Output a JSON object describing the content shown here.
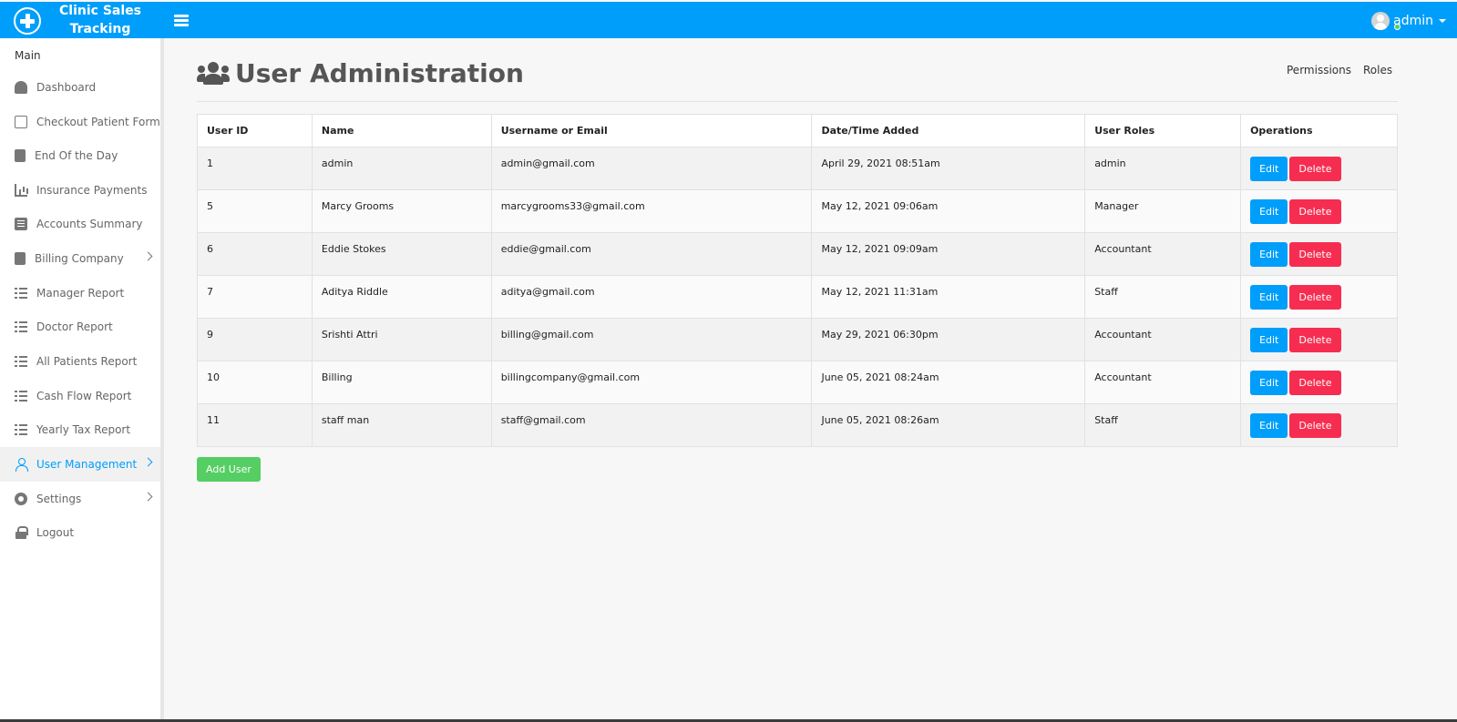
{
  "app": {
    "title_line1": "Clinic Sales",
    "title_line2": "Tracking",
    "user_name": "admin"
  },
  "colors": {
    "primary": "#009efb",
    "danger": "#f62d51",
    "success": "#55ce63"
  },
  "sidebar": {
    "section": "Main",
    "items": [
      {
        "label": "Dashboard",
        "icon": "dashboard-icon"
      },
      {
        "label": "Checkout Patient Form",
        "icon": "note-icon"
      },
      {
        "label": "End Of the Day",
        "icon": "clipboard-icon"
      },
      {
        "label": "Insurance Payments",
        "icon": "chart-icon"
      },
      {
        "label": "Accounts Summary",
        "icon": "list-icon"
      },
      {
        "label": "Billing Company",
        "icon": "clipboard-icon",
        "submenu": true
      },
      {
        "label": "Manager Report",
        "icon": "tasks-icon"
      },
      {
        "label": "Doctor Report",
        "icon": "tasks-icon"
      },
      {
        "label": "All Patients Report",
        "icon": "tasks-icon"
      },
      {
        "label": "Cash Flow Report",
        "icon": "tasks-icon"
      },
      {
        "label": "Yearly Tax Report",
        "icon": "tasks-icon"
      },
      {
        "label": "User Management",
        "icon": "user-icon",
        "submenu": true,
        "active": true
      },
      {
        "label": "Settings",
        "icon": "gear-icon",
        "submenu": true
      },
      {
        "label": "Logout",
        "icon": "lock-icon"
      }
    ]
  },
  "page": {
    "title": "User Administration",
    "links": {
      "permissions": "Permissions",
      "roles": "Roles"
    }
  },
  "table": {
    "headers": [
      "User ID",
      "Name",
      "Username or Email",
      "Date/Time Added",
      "User Roles",
      "Operations"
    ],
    "rows": [
      {
        "id": "1",
        "name": "admin",
        "email": "admin@gmail.com",
        "added": "April 29, 2021 08:51am",
        "role": "admin"
      },
      {
        "id": "5",
        "name": "Marcy Grooms",
        "email": "marcygrooms33@gmail.com",
        "added": "May 12, 2021 09:06am",
        "role": "Manager"
      },
      {
        "id": "6",
        "name": "Eddie Stokes",
        "email": "eddie@gmail.com",
        "added": "May 12, 2021 09:09am",
        "role": "Accountant"
      },
      {
        "id": "7",
        "name": "Aditya Riddle",
        "email": "aditya@gmail.com",
        "added": "May 12, 2021 11:31am",
        "role": "Staff"
      },
      {
        "id": "9",
        "name": "Srishti Attri",
        "email": "billing@gmail.com",
        "added": "May 29, 2021 06:30pm",
        "role": "Accountant"
      },
      {
        "id": "10",
        "name": "Billing",
        "email": "billingcompany@gmail.com",
        "added": "June 05, 2021 08:24am",
        "role": "Accountant"
      },
      {
        "id": "11",
        "name": "staff man",
        "email": "staff@gmail.com",
        "added": "June 05, 2021 08:26am",
        "role": "Staff"
      }
    ],
    "edit_label": "Edit",
    "delete_label": "Delete"
  },
  "actions": {
    "add_user": "Add User"
  }
}
